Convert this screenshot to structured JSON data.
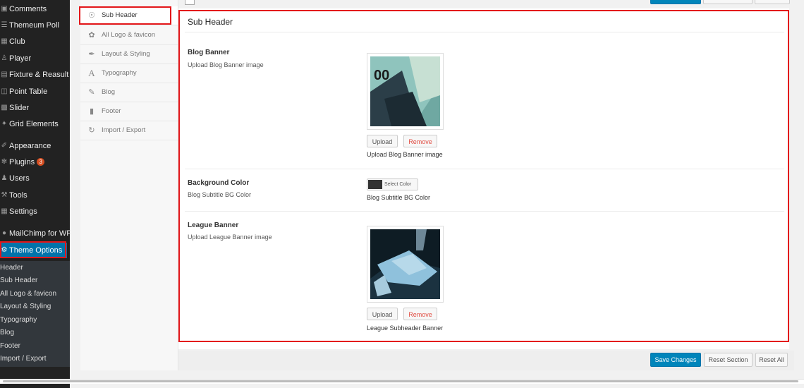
{
  "sidebar": {
    "items": [
      {
        "label": "Comments",
        "icon": "comment-icon"
      },
      {
        "label": "Themeum Poll",
        "icon": "list-icon"
      },
      {
        "label": "Club",
        "icon": "grid-icon"
      },
      {
        "label": "Player",
        "icon": "player-icon"
      },
      {
        "label": "Fixture & Reasult",
        "icon": "calendar-icon"
      },
      {
        "label": "Point Table",
        "icon": "table-icon"
      },
      {
        "label": "Slider",
        "icon": "slider-icon"
      },
      {
        "label": "Grid Elements",
        "icon": "puzzle-icon"
      },
      {
        "label": "Appearance",
        "icon": "brush-icon"
      },
      {
        "label": "Plugins",
        "icon": "plugin-icon",
        "badge": "3"
      },
      {
        "label": "Users",
        "icon": "users-icon"
      },
      {
        "label": "Tools",
        "icon": "wrench-icon"
      },
      {
        "label": "Settings",
        "icon": "settings-icon"
      },
      {
        "label": "MailChimp for WP",
        "icon": "mailchimp-icon"
      },
      {
        "label": "Theme Options",
        "icon": "theme-options-icon"
      }
    ],
    "submenu": [
      "Header",
      "Sub Header",
      "All Logo & favicon",
      "Layout & Styling",
      "Typography",
      "Blog",
      "Footer",
      "Import / Export"
    ]
  },
  "options_nav": {
    "items": [
      {
        "label": "Sub Header",
        "icon": "compass-icon"
      },
      {
        "label": "All Logo & favicon",
        "icon": "leaf-icon"
      },
      {
        "label": "Layout & Styling",
        "icon": "pencil-icon"
      },
      {
        "label": "Typography",
        "icon": "typography-icon"
      },
      {
        "label": "Blog",
        "icon": "edit-icon"
      },
      {
        "label": "Footer",
        "icon": "bookmark-icon"
      },
      {
        "label": "Import / Export",
        "icon": "refresh-icon"
      }
    ]
  },
  "section": {
    "title": "Sub Header",
    "fields": [
      {
        "title": "Blog Banner",
        "subtitle": "Upload Blog Banner image",
        "upload": "Upload",
        "remove": "Remove",
        "desc": "Upload Blog Banner image"
      },
      {
        "title": "Background Color",
        "subtitle": "Blog Subtitle BG Color",
        "button": "Select Color",
        "desc": "Blog Subtitle BG Color",
        "color": "#333333"
      },
      {
        "title": "League Banner",
        "subtitle": "Upload League Banner image",
        "upload": "Upload",
        "remove": "Remove",
        "desc": "League Subheader Banner"
      }
    ]
  },
  "footer": {
    "save": "Save Changes",
    "reset_section": "Reset Section",
    "reset_all": "Reset All"
  },
  "colors": {
    "highlight": "#e3161a",
    "primary": "#0085ba",
    "sidebar_bg": "#222222",
    "active": "#0073aa"
  }
}
